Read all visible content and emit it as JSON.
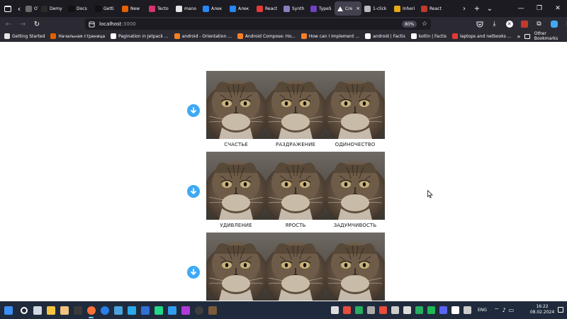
{
  "tabs": [
    {
      "label": "OT",
      "color": "#6b6b6b"
    },
    {
      "label": "Demy",
      "color": "#2b2b2b",
      "badge": "IIIV"
    },
    {
      "label": "Docs",
      "color": "#111111",
      "badge": "N"
    },
    {
      "label": "Getti",
      "color": "#111111",
      "badge": "N"
    },
    {
      "label": "New",
      "color": "#e66000"
    },
    {
      "label": "Tecto",
      "color": "#d6336c"
    },
    {
      "label": "mano",
      "color": "#e5e5e5"
    },
    {
      "label": "Алек",
      "color": "#2787f5"
    },
    {
      "label": "Алек",
      "color": "#2787f5"
    },
    {
      "label": "React",
      "color": "#e53935"
    },
    {
      "label": "Synth",
      "color": "#8e7cc3"
    },
    {
      "label": "TypeS",
      "color": "#6f42c1"
    },
    {
      "label": "Cre",
      "color": "#ffffff",
      "active": true
    },
    {
      "label": "1-click",
      "color": "#bbbbbb"
    },
    {
      "label": "Inheri",
      "color": "#e6a817"
    },
    {
      "label": "React",
      "color": "#c0392b"
    }
  ],
  "tab_close_glyph": "×",
  "new_tab_glyph": "+",
  "window": {
    "minimize": "—",
    "restore": "❐",
    "close": "✕"
  },
  "nav": {
    "url_host": "localhost",
    "url_port": ":3000",
    "zoom": "80%"
  },
  "bookmarks": [
    {
      "label": "Getting Started",
      "color": "#e5e5e5"
    },
    {
      "label": "Начальная страница",
      "color": "#e66000"
    },
    {
      "label": "Pagination in Jetpack ...",
      "color": "#ffffff"
    },
    {
      "label": "android - Orientation ...",
      "color": "#f48024"
    },
    {
      "label": "Android Compose: Ho...",
      "color": "#f48024"
    },
    {
      "label": "How can I implement ...",
      "color": "#f48024"
    },
    {
      "label": "android | Factis",
      "color": "#ffffff"
    },
    {
      "label": "kotlin | Factis",
      "color": "#ffffff"
    },
    {
      "label": "laptops and netbooks ...",
      "color": "#e53935",
      "badge": "L"
    }
  ],
  "other_bookmarks": "Other Bookmarks",
  "emotions": [
    {
      "label": "СЧАСТЬЕ"
    },
    {
      "label": "РАЗДРАЖЕНИЕ"
    },
    {
      "label": "ОДИНОЧЕСТВО"
    },
    {
      "label": "УДИВЛЕНИЕ"
    },
    {
      "label": "ЯРОСТЬ"
    },
    {
      "label": "ЗАДУМЧИВОСТЬ"
    },
    {
      "label": ""
    },
    {
      "label": ""
    },
    {
      "label": ""
    }
  ],
  "accent_color": "#3fa9f5",
  "taskbar": {
    "lang": "ENG",
    "time": "16:22",
    "date": "08.02.2024",
    "apps": [
      {
        "name": "start",
        "color": "#3a8ef6"
      },
      {
        "name": "search",
        "color": "#ffffff"
      },
      {
        "name": "task-view",
        "color": "#cfd8e3"
      },
      {
        "name": "explorer",
        "color": "#f5c542"
      },
      {
        "name": "hand",
        "color": "#f2c280"
      },
      {
        "name": "terminal",
        "color": "#3a3a3a"
      },
      {
        "name": "firefox",
        "color": "#ff7139",
        "active": true
      },
      {
        "name": "chrome",
        "color": "#2b7de9"
      },
      {
        "name": "notepad",
        "color": "#4aa3df"
      },
      {
        "name": "telegram",
        "color": "#29a9eb"
      },
      {
        "name": "defender",
        "color": "#2f6fd6"
      },
      {
        "name": "pycharm",
        "color": "#21d789"
      },
      {
        "name": "vscode",
        "color": "#2f9cf0"
      },
      {
        "name": "rider",
        "color": "#b03ad8"
      },
      {
        "name": "obs",
        "color": "#3d3d3d"
      },
      {
        "name": "minecraft",
        "color": "#7a5a3a"
      }
    ],
    "tray": [
      "#dddddd",
      "#e74c3c",
      "#27ae60",
      "#aaaaaa",
      "#e74c3c",
      "#cccccc",
      "#dddddd",
      "#27ae60",
      "#1db954",
      "#5865f2",
      "#ffffff",
      "#cccccc"
    ]
  }
}
